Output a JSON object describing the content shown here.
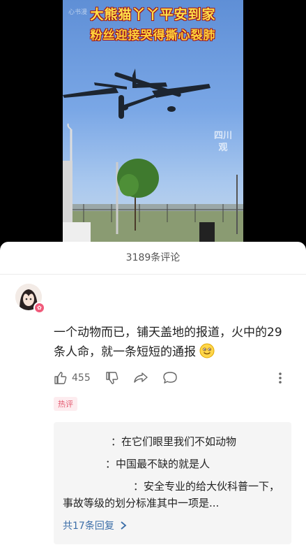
{
  "video": {
    "watermark": "心书漫",
    "caption_line1": "大熊猫丫丫平安到家",
    "caption_line2": "粉丝迎接哭得撕心裂肺",
    "logo_line1": "四川",
    "logo_line2": "观"
  },
  "comments": {
    "count_label": "3189条评论",
    "top_comment": {
      "text": "一个动物而已，铺天盖地的报道，火中的29条人命，就一条短短的通报",
      "emoji": "smile-face",
      "likes": "455",
      "tag": "热评"
    },
    "replies": [
      {
        "text": "：在它们眼里我们不如动物"
      },
      {
        "text": "：中国最不缺的就是人"
      },
      {
        "text": "：安全专业的给大伙科普一下，事故等级的划分标准其中一项是..."
      }
    ],
    "more_replies": "共17条回复"
  }
}
